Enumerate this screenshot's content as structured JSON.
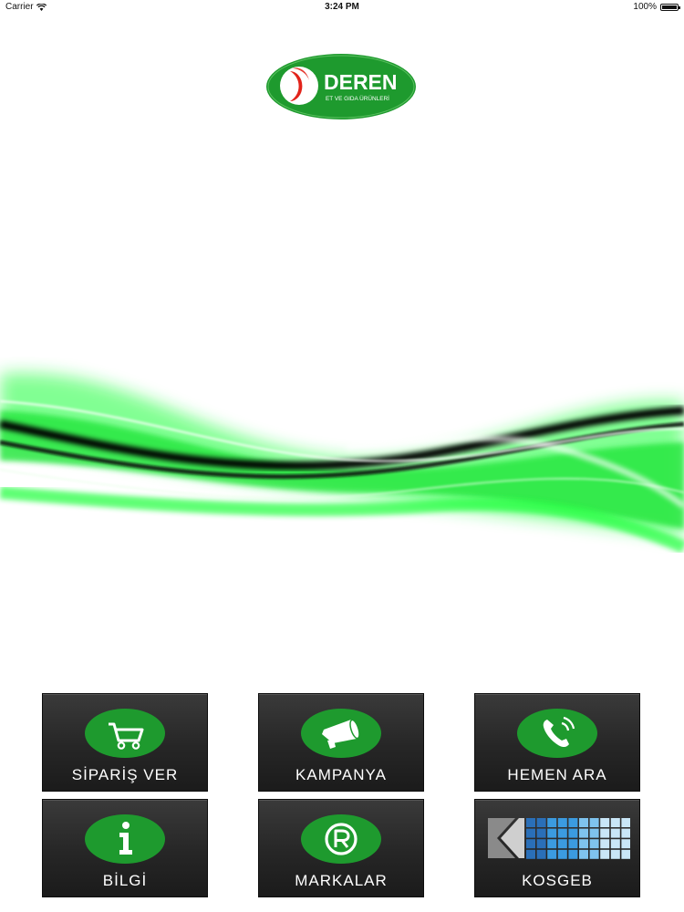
{
  "status_bar": {
    "carrier": "Carrier",
    "time": "3:24 PM",
    "battery": "100%",
    "battery_level": 1.0
  },
  "logo": {
    "name": "DEREN",
    "tagline": "ET VE GIDA ÜRÜNLERİ"
  },
  "colors": {
    "brand_green": "#1e9a2e",
    "logo_red": "#e2231a",
    "tile_bg": "#2a2a2a",
    "tile_text": "#ffffff",
    "wave_green": "#1dff3a"
  },
  "menu": [
    {
      "label": "SİPARİŞ VER",
      "icon": "shopping-cart-icon"
    },
    {
      "label": "KAMPANYA",
      "icon": "megaphone-icon"
    },
    {
      "label": "HEMEN ARA",
      "icon": "phone-icon"
    },
    {
      "label": "BİLGİ",
      "icon": "info-icon"
    },
    {
      "label": "MARKALAR",
      "icon": "registered-trademark-icon"
    },
    {
      "label": "KOSGEB",
      "icon": "kosgeb-logo-icon"
    }
  ]
}
